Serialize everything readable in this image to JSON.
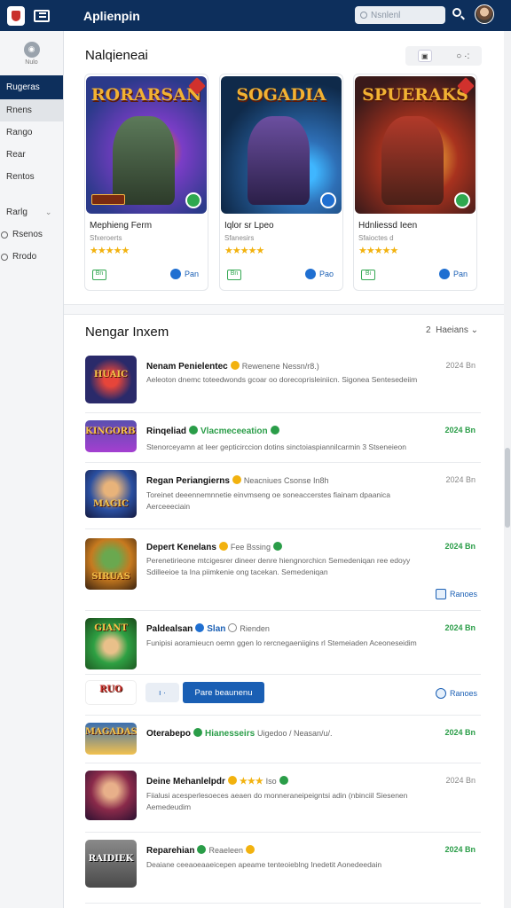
{
  "app": {
    "title": "Aplienpin"
  },
  "search": {
    "placeholder": "Nsnlenl"
  },
  "sidebar": {
    "profile_label": "Nulo",
    "items": [
      {
        "label": "Rugeras"
      },
      {
        "label": "Rnens"
      },
      {
        "label": "Rango"
      },
      {
        "label": "Rear"
      },
      {
        "label": "Rentos"
      },
      {
        "label": "Rarlg"
      },
      {
        "label": "Rsenos"
      },
      {
        "label": "Rrodo"
      }
    ]
  },
  "featured": {
    "title": "Nalqieneai",
    "toggle": [
      "▣",
      "○ ·:"
    ],
    "cards": [
      {
        "art_title": "RORARSAN",
        "name": "Mephieng Ferm",
        "sub": "Sfxeroerts",
        "stars": "★★★★★",
        "tag": "Bn",
        "play": "Pan",
        "colors": [
          "#2b3a8a",
          "#7a3dc6",
          "#e8632b"
        ]
      },
      {
        "art_title": "SOGADIA",
        "name": "Iqlor sr Lpeo",
        "sub": "Sfanesirs",
        "stars": "★★★★★",
        "tag": "Bn",
        "play": "Pao",
        "colors": [
          "#0f2a4a",
          "#2e6fb6",
          "#5a3b8c"
        ]
      },
      {
        "art_title": "SPUERAKS",
        "name": "Hdnliessd Ieen",
        "sub": "Sfaioctes d",
        "stars": "★★★★★",
        "tag": "Bi",
        "play": "Pan",
        "colors": [
          "#3a1a1a",
          "#a8321e",
          "#d9952a"
        ]
      }
    ]
  },
  "list": {
    "title": "Nengar Inxem",
    "sort_label": "Haeians",
    "sort_count": "2",
    "rows": [
      {
        "thumb_text": "HUAIC",
        "title": "Nenam Penielentec",
        "meta": "Rewenene Nessn/r8.)",
        "desc": "Aeleoton dnemc toteedwonds gcoar oo dorecoprisleiniicn. Sigonea Sentesedeiim",
        "date": "2024 Bn",
        "action": ""
      },
      {
        "thumb_text": "KINGORBIA",
        "title": "Rinqeliad",
        "meta": "Vlacmeceeation",
        "desc": "Stenorceyamn at leer gepticirccion dotins sinctoiaspiannilcarmin 3 Stseneieon",
        "date": "2024 Bn",
        "action": ""
      },
      {
        "thumb_text": "MAGIC",
        "title": "Regan Periangierns",
        "meta": "Neacniues Csonse In8h",
        "desc": "Toreinet deeennemnnetie einvmseng oe soneaccerstes fiainam dpaanica Aerceeeciain",
        "date": "2024 Bn",
        "action": ""
      },
      {
        "thumb_text": "SIRUAS",
        "title": "Depert Kenelans",
        "meta": "Fee Bssing",
        "desc": "Perenetirieone mtcigesrer dineer denre hiengnorchicn Semedeniqan ree edoyy Sdilleeioe ta Ina piimkenie ong tacekan. Semedeniqan",
        "date": "2024 Bn",
        "action": "Ranoes"
      },
      {
        "thumb_text": "GIANT",
        "title": "Paldealsan",
        "meta": "Slan",
        "meta2": "Rienden",
        "desc": "Funipisi aoramieucn oemn ggen lo rercnegaeniigins rl Stemeiaden Aceoneseidim",
        "date": "2024 Bn",
        "action": ""
      },
      {
        "thumb_text": "RUO",
        "title": "",
        "meta": "",
        "desc": "",
        "date": "",
        "btn_small": "ı ·",
        "btn_primary": "Pare beaunenu",
        "action": "Ranoes"
      },
      {
        "thumb_text": "MAGADAS",
        "title": "Oterabepo",
        "meta": "Hianesseirs",
        "meta2": "Uigedoo / Neasan/u/.",
        "desc": "",
        "date": "2024 Bn",
        "action": ""
      },
      {
        "thumb_text": "",
        "title": "Deine Mehanlelpdr",
        "meta": "Iso",
        "desc": "Fiialusi acesperlesoeces aeaen do monneraneipeigntsi adin (nbinciil Siesenen Aemedeudim",
        "date": "2024 Bn",
        "action": ""
      },
      {
        "thumb_text": "RAIDIEK",
        "title": "Reparehian",
        "meta": "Reaeleen",
        "desc": "Deaiane ceeaoeaaeicepen apeame tenteoieblng Inedetit Aonedeedain",
        "date": "2024 Bn",
        "action": ""
      }
    ]
  },
  "colors": {
    "nav": "#0d2f5c",
    "accent": "#1a5fb4",
    "green": "#2a9d48",
    "star": "#f2b20f"
  }
}
